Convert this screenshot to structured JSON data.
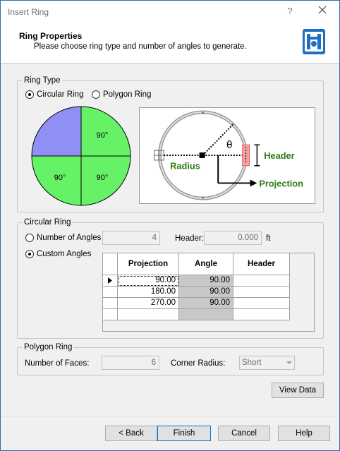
{
  "window": {
    "title": "Insert Ring",
    "help_glyph": "?",
    "close_icon": "close-icon"
  },
  "header": {
    "title": "Ring Properties",
    "subtitle": "Please choose ring type and number of angles to generate.",
    "icon": "ring-wizard-icon"
  },
  "ring_type": {
    "group_label": "Ring Type",
    "options": [
      {
        "label": "Circular Ring",
        "selected": true
      },
      {
        "label": "Polygon Ring",
        "selected": false
      }
    ],
    "pie": {
      "quadrants": [
        {
          "label": "",
          "color": "#8f8ff5"
        },
        {
          "label": "90°",
          "color": "#66f266"
        },
        {
          "label": "90°",
          "color": "#66f266"
        },
        {
          "label": "90°",
          "color": "#66f266"
        }
      ]
    },
    "diagram": {
      "theta": "θ",
      "header_label": "Header",
      "radius_label": "Radius",
      "projection_label": "Projection",
      "label_color": "#2e7d12"
    }
  },
  "circular_ring": {
    "group_label": "Circular Ring",
    "number_of_angles_label": "Number of Angles",
    "number_of_angles_value": "4",
    "number_of_angles_selected": false,
    "header_label": "Header:",
    "header_value": "0.000",
    "header_unit": "ft",
    "custom_angles_label": "Custom Angles",
    "custom_angles_selected": true,
    "table": {
      "columns": [
        "Projection",
        "Angle",
        "Header"
      ],
      "rows": [
        {
          "projection": "90.00",
          "angle": "90.00",
          "header": "",
          "current": true
        },
        {
          "projection": "180.00",
          "angle": "90.00",
          "header": ""
        },
        {
          "projection": "270.00",
          "angle": "90.00",
          "header": ""
        },
        {
          "projection": "",
          "angle": "",
          "header": ""
        }
      ]
    }
  },
  "polygon_ring": {
    "group_label": "Polygon Ring",
    "faces_label": "Number of Faces:",
    "faces_value": "6",
    "corner_radius_label": "Corner Radius:",
    "corner_radius_value": "Short"
  },
  "buttons": {
    "view_data": "View Data",
    "back": "< Back",
    "finish": "Finish",
    "cancel": "Cancel",
    "help": "Help"
  }
}
